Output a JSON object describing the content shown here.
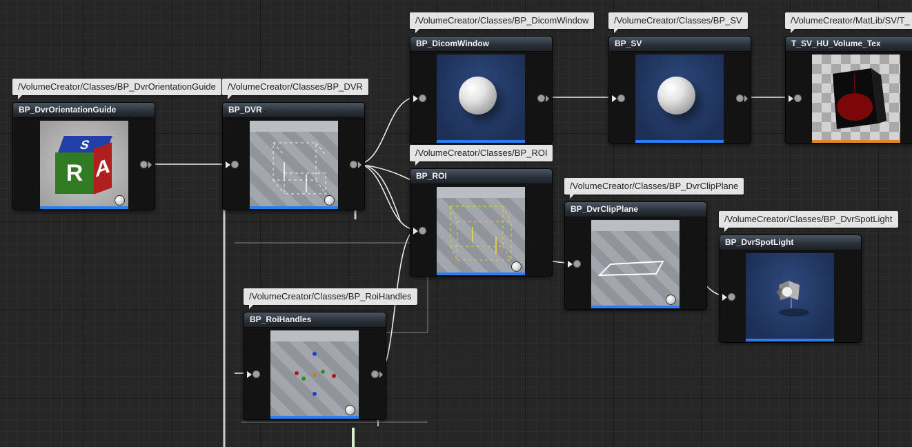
{
  "graph": {
    "nodes": [
      {
        "id": "orientation",
        "title": "BP_DvrOrientationGuide",
        "path": "/VolumeCreator/Classes/BP_DvrOrientationGuide",
        "thumbnail": "letter-cube"
      },
      {
        "id": "dvr",
        "title": "BP_DVR",
        "path": "/VolumeCreator/Classes/BP_DVR",
        "thumbnail": "wire-box"
      },
      {
        "id": "dicom",
        "title": "BP_DicomWindow",
        "path": "/VolumeCreator/Classes/BP_DicomWindow",
        "thumbnail": "sphere"
      },
      {
        "id": "sv",
        "title": "BP_SV",
        "path": "/VolumeCreator/Classes/BP_SV",
        "thumbnail": "sphere"
      },
      {
        "id": "tex",
        "title": "T_SV_HU_Volume_Tex",
        "path": "/VolumeCreator/MatLib/SV/T_",
        "thumbnail": "volume-texture"
      },
      {
        "id": "roi",
        "title": "BP_ROI",
        "path": "/VolumeCreator/Classes/BP_ROI",
        "thumbnail": "wire-box-yellow"
      },
      {
        "id": "clip",
        "title": "BP_DvrClipPlane",
        "path": "/VolumeCreator/Classes/BP_DvrClipPlane",
        "thumbnail": "plane"
      },
      {
        "id": "spot",
        "title": "BP_DvrSpotLight",
        "path": "/VolumeCreator/Classes/BP_DvrSpotLight",
        "thumbnail": "spotlight"
      },
      {
        "id": "handles",
        "title": "BP_RoiHandles",
        "path": "/VolumeCreator/Classes/BP_RoiHandles",
        "thumbnail": "handles"
      }
    ],
    "cube_letters": {
      "top": "S",
      "front": "R",
      "side": "A"
    }
  },
  "colors": {
    "canvas": "#262626",
    "wire": "#e8ece4",
    "header": "#2a3038",
    "accent_bar": "#2f7df6",
    "texture_bar": "#e08a2c"
  }
}
